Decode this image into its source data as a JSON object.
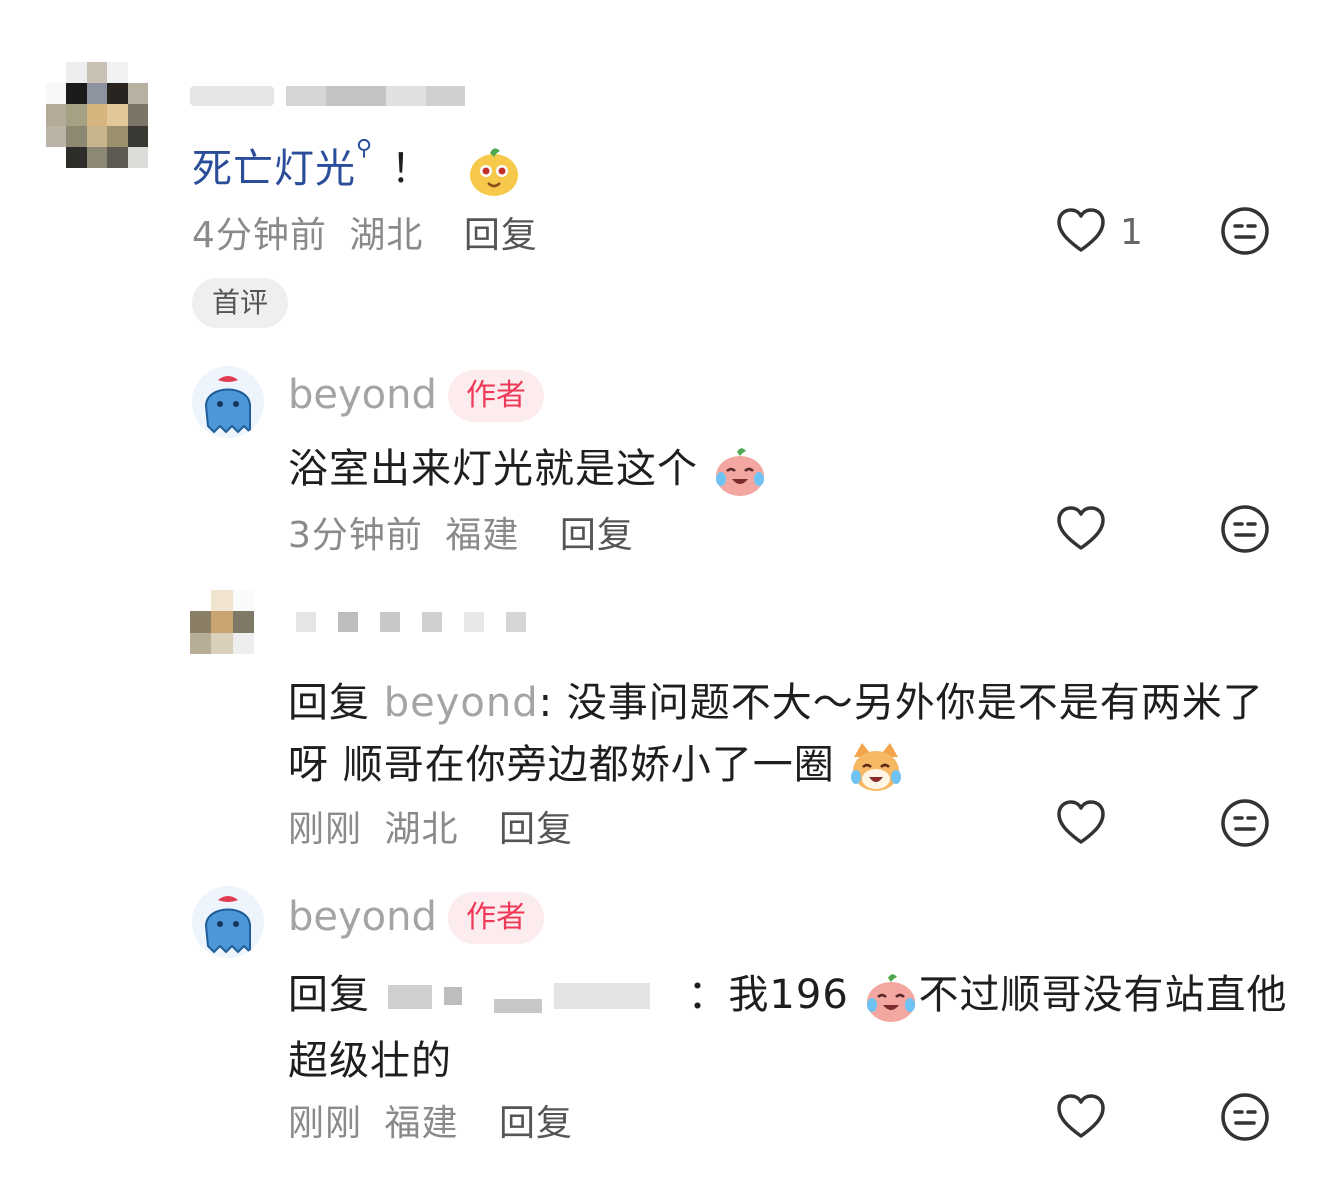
{
  "comments": [
    {
      "text": "死亡灯光",
      "text_suffix": "！",
      "time": "4分钟前",
      "location": "湖北",
      "reply_label": "回复",
      "like_count": "1",
      "tag": "首评"
    }
  ],
  "replies": [
    {
      "author": "beyond",
      "badge": "作者",
      "text": "浴室出来灯光就是这个",
      "time": "3分钟前",
      "location": "福建",
      "reply_label": "回复"
    },
    {
      "reply_prefix": "回复",
      "reply_to": "beyond",
      "text_line1": ": 没事问题不大～另外你是不是有两米了",
      "text_line2": "呀 顺哥在你旁边都娇小了一圈",
      "time": "刚刚",
      "location": "湖北",
      "reply_label": "回复"
    },
    {
      "author": "beyond",
      "badge": "作者",
      "reply_prefix": "回复",
      "text_line1_a": "：我196",
      "text_line1_b": "不过顺哥没有站直他",
      "text_line2": "超级壮的",
      "time": "刚刚",
      "location": "福建",
      "reply_label": "回复"
    }
  ],
  "icons": {
    "like": "heart-outline-icon",
    "dislike": "neutral-face-icon",
    "search_hint": "search-icon"
  },
  "colors": {
    "link": "#2b4e9a",
    "badge_text": "#ee3a58",
    "badge_bg": "#fdeced",
    "meta": "#8a8a8a"
  }
}
